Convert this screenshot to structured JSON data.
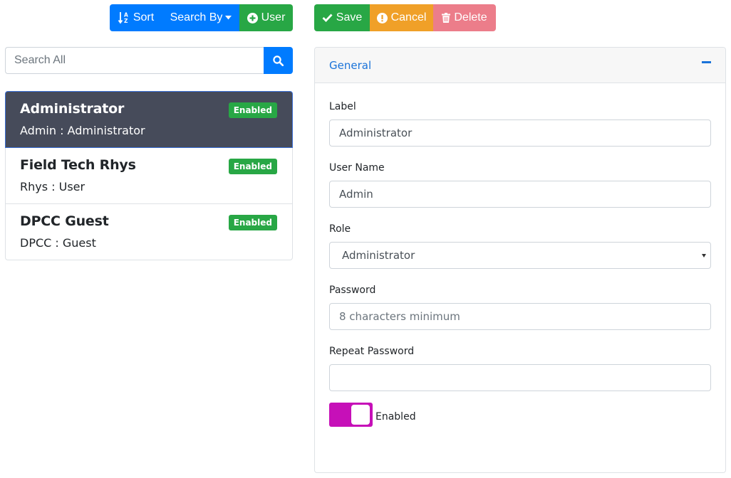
{
  "toolbar": {
    "sort_label": "Sort",
    "search_by_label": "Search By",
    "add_user_label": "User"
  },
  "actions": {
    "save_label": "Save",
    "cancel_label": "Cancel",
    "delete_label": "Delete"
  },
  "search": {
    "placeholder": "Search All"
  },
  "users": [
    {
      "name": "Administrator",
      "subtitle": "Admin : Administrator",
      "status": "Enabled",
      "selected": true
    },
    {
      "name": "Field Tech Rhys",
      "subtitle": "Rhys : User",
      "status": "Enabled",
      "selected": false
    },
    {
      "name": "DPCC Guest",
      "subtitle": "DPCC : Guest",
      "status": "Enabled",
      "selected": false
    }
  ],
  "panel": {
    "title": "General",
    "fields": {
      "label": {
        "label": "Label",
        "value": "Administrator"
      },
      "username": {
        "label": "User Name",
        "value": "Admin"
      },
      "role": {
        "label": "Role",
        "value": "Administrator"
      },
      "password": {
        "label": "Password",
        "placeholder": "8 characters minimum"
      },
      "repeat_password": {
        "label": "Repeat Password",
        "value": ""
      }
    },
    "enabled_toggle": {
      "label": "Enabled",
      "on": true
    }
  },
  "colors": {
    "primary": "#007bff",
    "success": "#28a745",
    "warning": "#f0a028",
    "danger_disabled": "#ec7d8a",
    "selected_item": "#464b5a",
    "toggle_on": "#c610b8",
    "panel_title": "#1a73d9"
  },
  "icons": {
    "sort": "sort-alpha-icon",
    "search_by": "caret-down-icon",
    "add_user": "plus-circle-icon",
    "save": "check-icon",
    "cancel": "exclamation-circle-icon",
    "delete": "trash-icon",
    "search": "search-icon",
    "collapse": "minus-icon"
  }
}
